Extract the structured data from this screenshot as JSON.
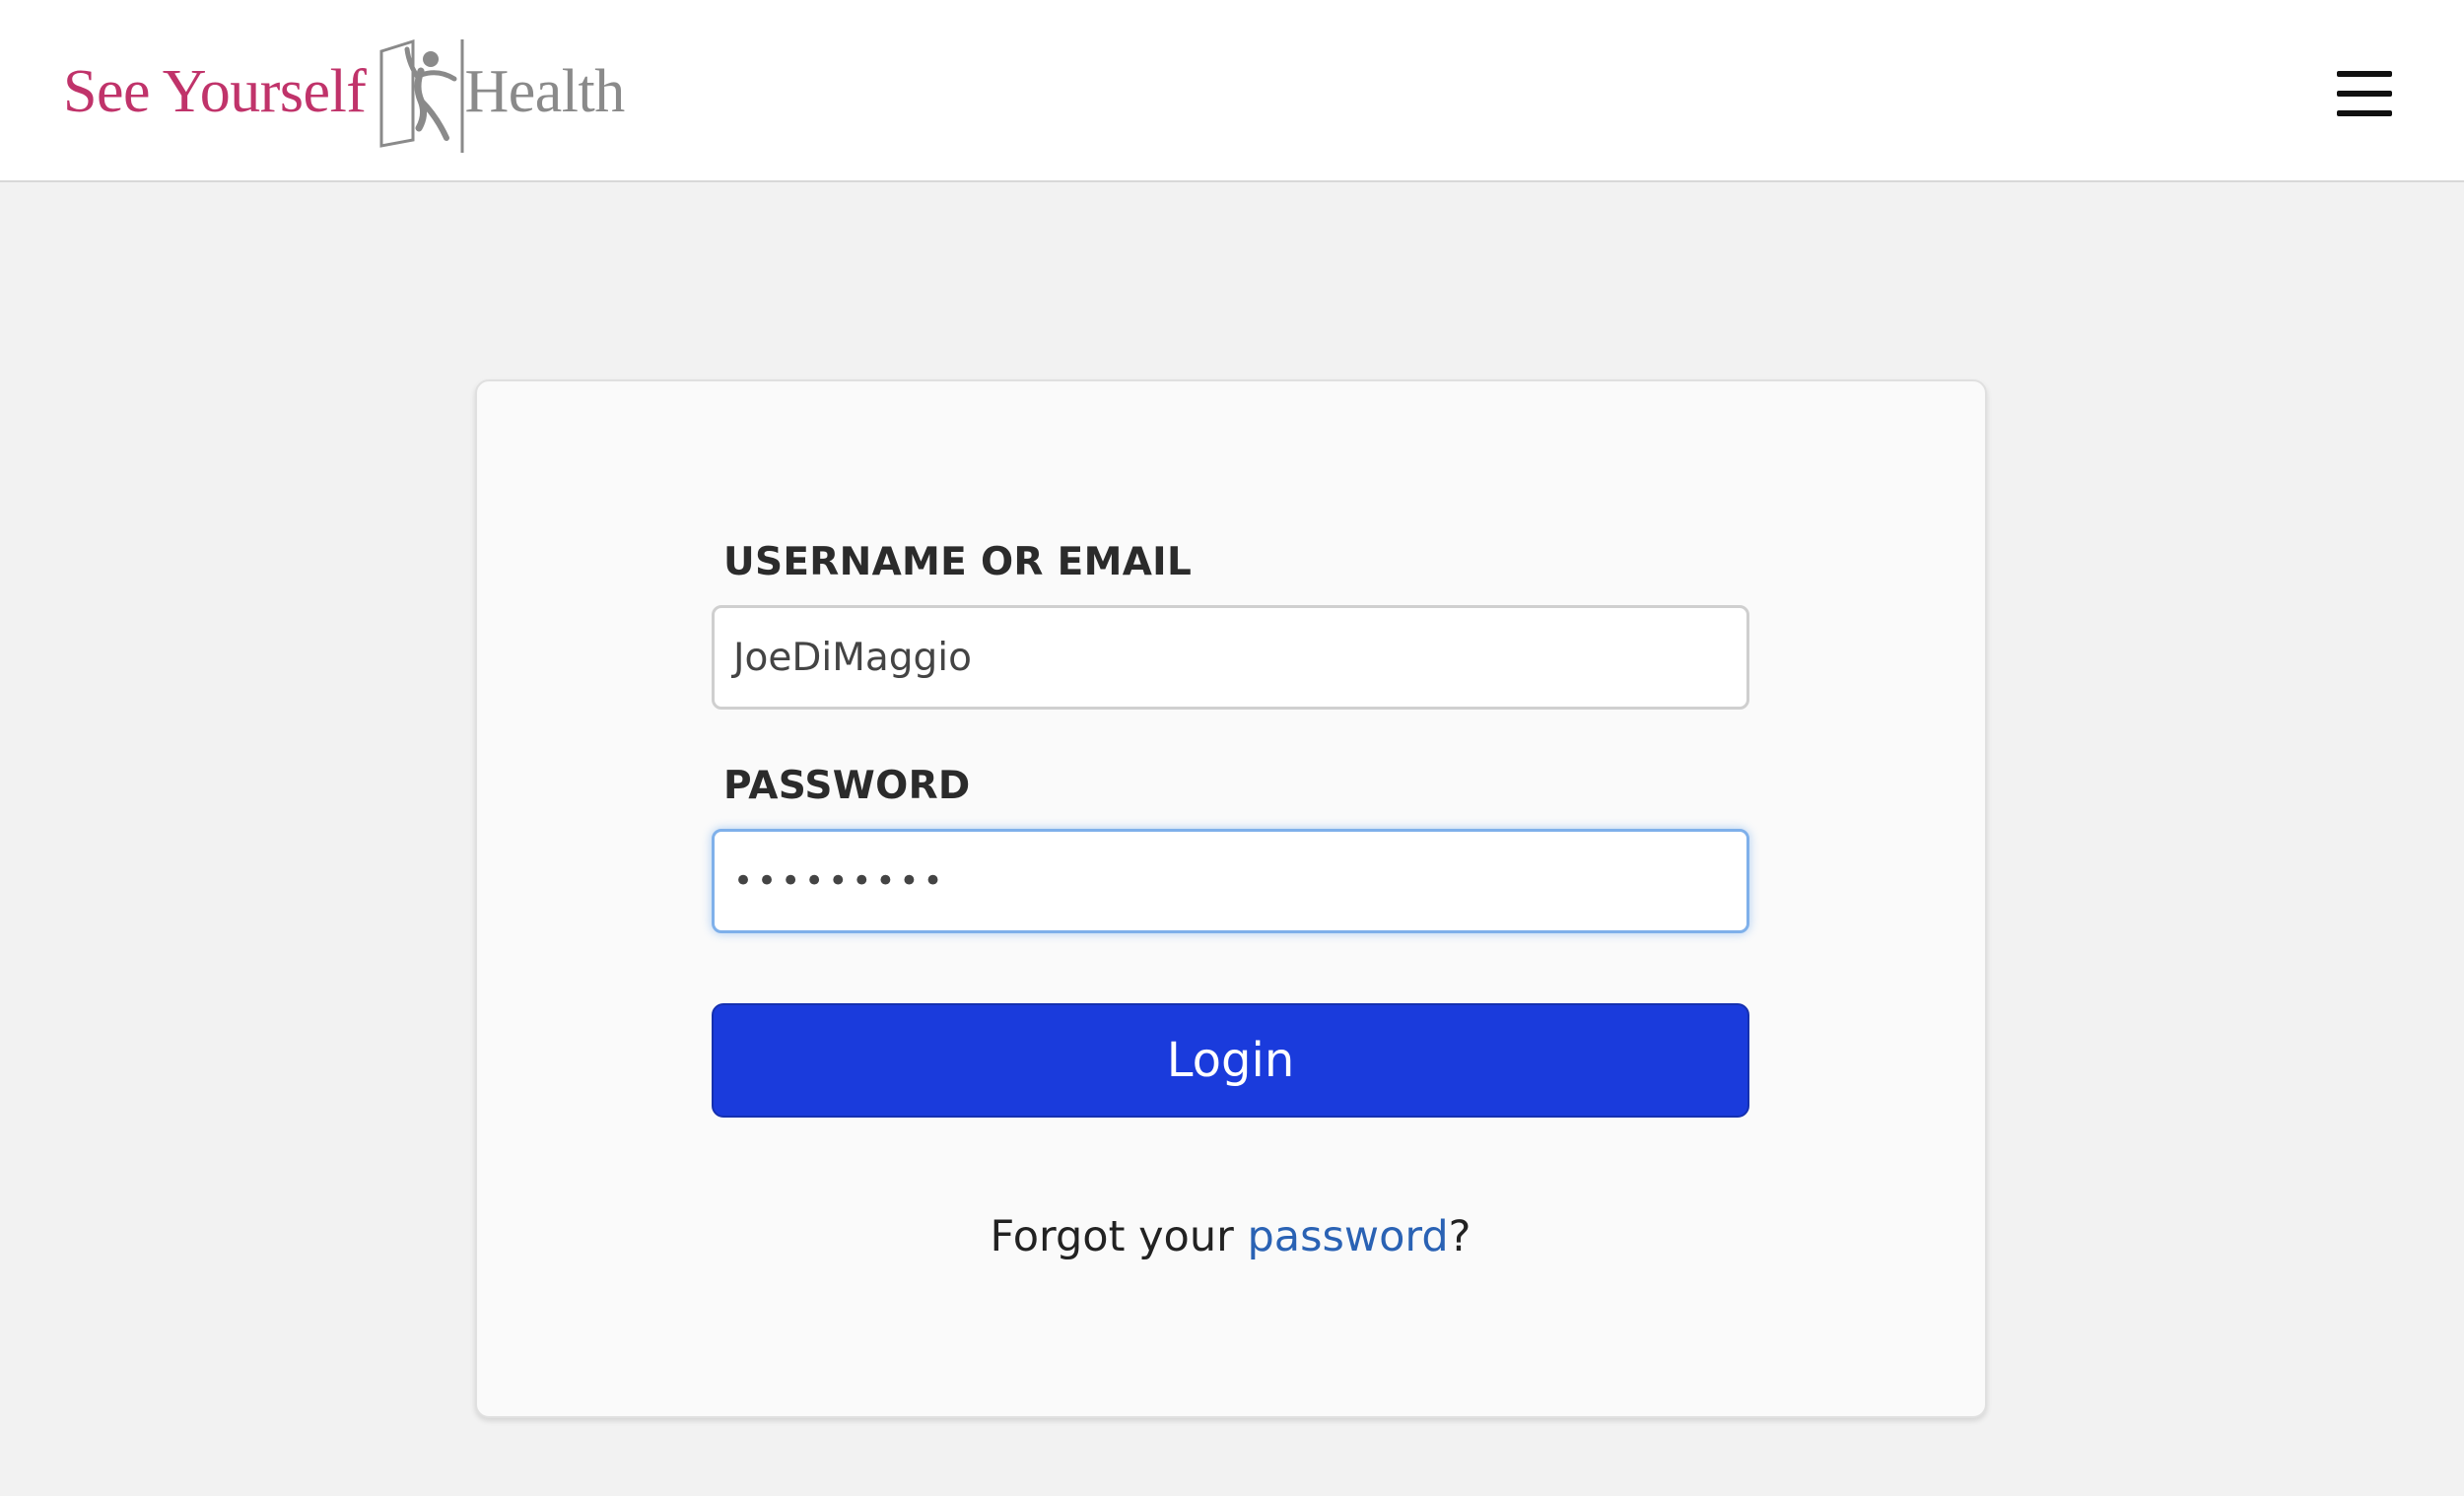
{
  "header": {
    "logo": {
      "text_left": "See Yourself",
      "text_right": "Health",
      "left_color": "#c0336a",
      "right_color": "#8a8a8a"
    },
    "menu_icon": "hamburger-menu-icon"
  },
  "login_form": {
    "username": {
      "label": "USERNAME OR EMAIL",
      "value": "JoeDiMaggio"
    },
    "password": {
      "label": "PASSWORD",
      "masked_value": "•••••••••"
    },
    "login_button": {
      "label": "Login",
      "color": "#1a3bdc"
    },
    "forgot": {
      "prefix": "Forgot your ",
      "link_text": "password",
      "suffix": "?",
      "link_color": "#2a62b4"
    }
  }
}
